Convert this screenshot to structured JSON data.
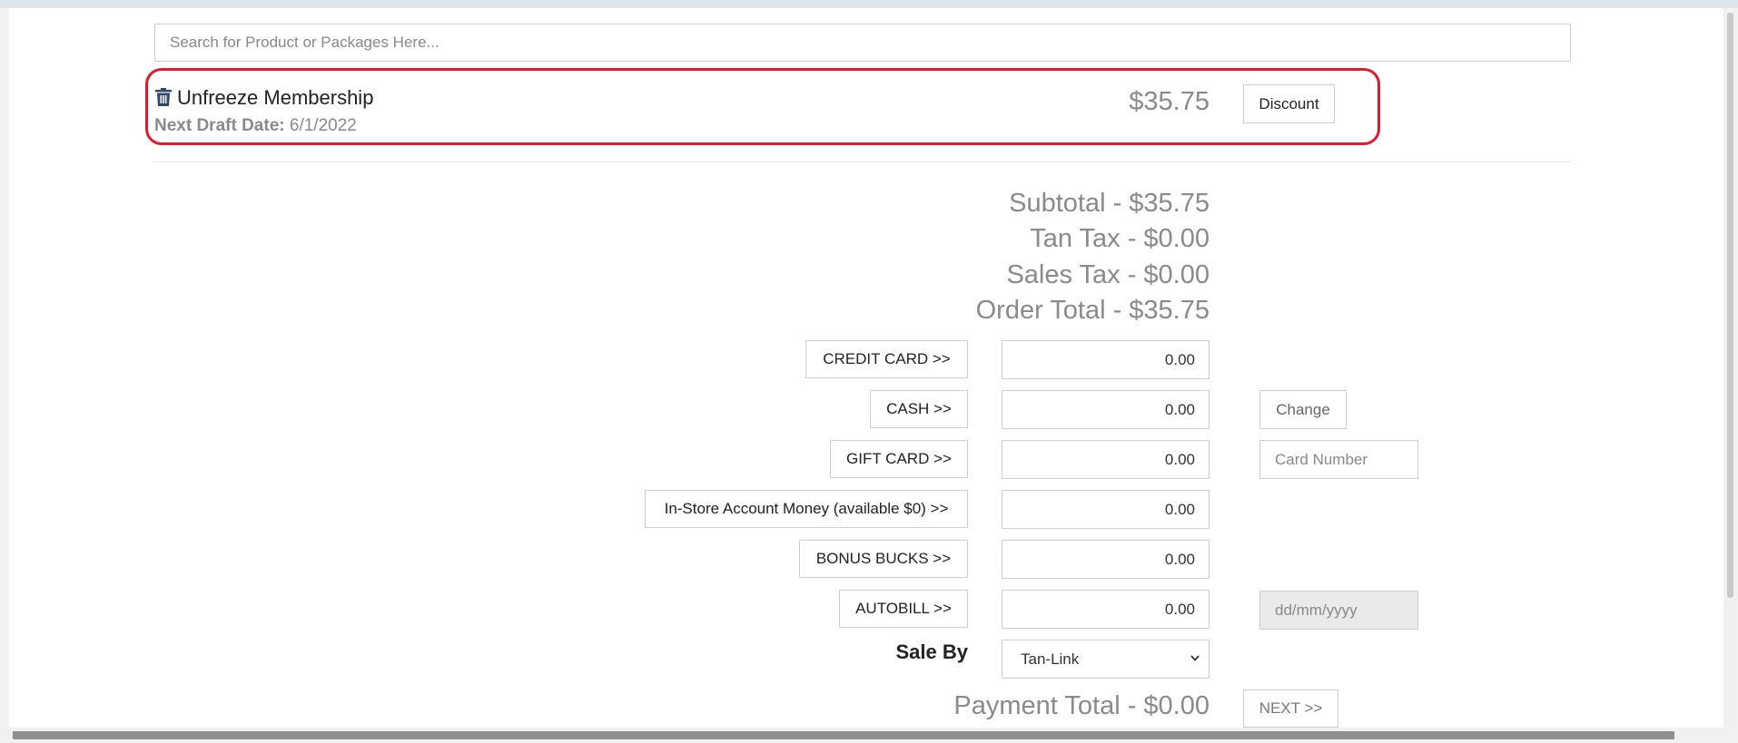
{
  "search": {
    "placeholder": "Search for Product or Packages Here..."
  },
  "cart_item": {
    "name": "Unfreeze Membership",
    "draft_label": "Next Draft Date:",
    "draft_value": "6/1/2022",
    "price": "$35.75",
    "discount_label": "Discount",
    "icons": {
      "remove": "trash-icon"
    }
  },
  "totals": {
    "subtotal": "Subtotal - $35.75",
    "tan_tax": "Tan Tax - $0.00",
    "sales_tax": "Sales Tax - $0.00",
    "order_total": "Order Total - $35.75"
  },
  "payments": [
    {
      "label": "CREDIT CARD >>",
      "amount": "0.00"
    },
    {
      "label": "CASH >>",
      "amount": "0.00"
    },
    {
      "label": "GIFT CARD >>",
      "amount": "0.00"
    },
    {
      "label": "In-Store Account Money (available $0) >>",
      "amount": "0.00"
    },
    {
      "label": "BONUS BUCKS >>",
      "amount": "0.00"
    },
    {
      "label": "AUTOBILL >>",
      "amount": "0.00"
    }
  ],
  "change_label": "Change",
  "card_number_placeholder": "Card Number",
  "autobill_date_placeholder": "dd/mm/yyyy",
  "sale_by": {
    "label": "Sale By",
    "selected": "Tan-Link"
  },
  "payment_total": "Payment Total - $0.00",
  "next_label": "NEXT >>",
  "colors": {
    "highlight": "#e01b2f",
    "icon": "#2c4a6e",
    "muted_text": "#8a8a8a"
  }
}
